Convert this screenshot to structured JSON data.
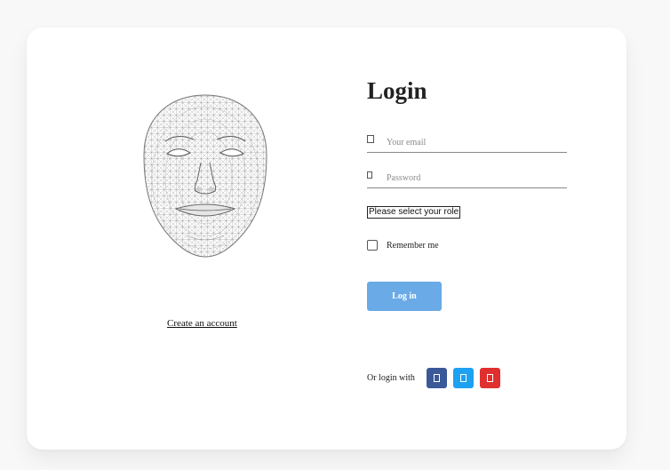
{
  "login": {
    "title": "Login",
    "email_placeholder": "Your email",
    "password_placeholder": "Password",
    "role_select": "Please select your role",
    "remember_label": "Remember me",
    "login_button": "Log in",
    "or_login_with": "Or login with"
  },
  "left": {
    "create_account": "Create an account"
  },
  "icons": {
    "email": "user-icon",
    "password": "lock-icon",
    "facebook": "facebook-icon",
    "twitter": "twitter-icon",
    "google": "google-icon"
  },
  "colors": {
    "login_button": "#6aaae6",
    "facebook": "#3b5998",
    "twitter": "#1da1f2",
    "google": "#e02f2f"
  }
}
